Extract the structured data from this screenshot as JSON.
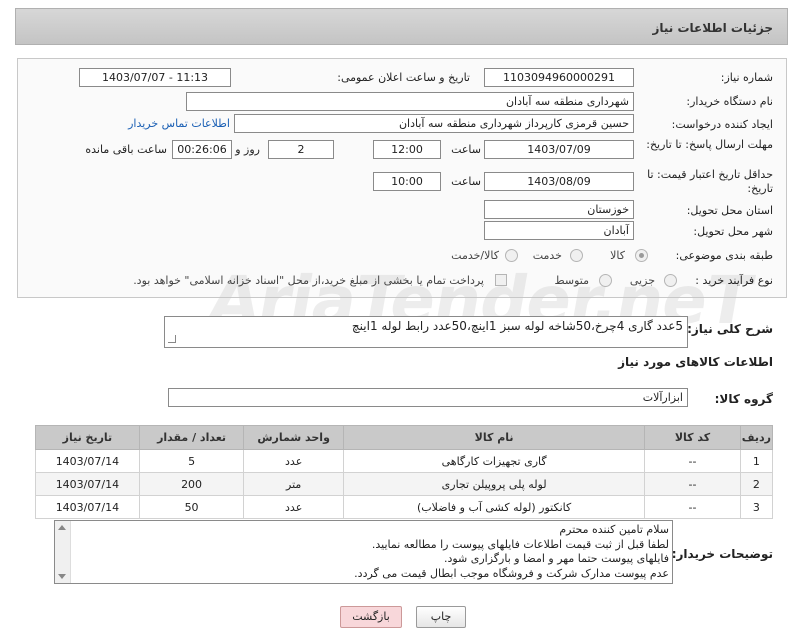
{
  "page": {
    "title": "جزئیات اطلاعات نیاز"
  },
  "labels": {
    "need_number": "شماره نیاز:",
    "announce_datetime": "تاریخ و ساعت اعلان عمومی:",
    "buyer_org": "نام دستگاه خریدار:",
    "requester": "ایجاد کننده درخواست:",
    "contact_link": "اطلاعات تماس خریدار",
    "reply_deadline": "مهلت ارسال پاسخ: تا تاریخ:",
    "hour": "ساعت",
    "day_and": "روز و",
    "remaining": "ساعت باقی مانده",
    "price_validity": "حداقل تاریخ اعتبار قیمت: تا تاریخ:",
    "delivery_province": "استان محل تحویل:",
    "delivery_city": "شهر محل تحویل:",
    "category": "طبقه بندی موضوعی:",
    "process_type": "نوع فرآیند خرید :",
    "general_desc": "شرح کلی نیاز:",
    "goods_info": "اطلاعات کالاهای مورد نیاز",
    "goods_group": "گروه کالا:",
    "buyer_notes": "توضیحات خریدار:"
  },
  "fields": {
    "need_number": "1103094960000291",
    "announce_datetime": "1403/07/07 - 11:13",
    "buyer_org": "شهرداری منطقه سه آبادان",
    "requester": "حسین قرمزی کارپرداز شهرداری منطقه سه آبادان",
    "reply_date": "1403/07/09",
    "reply_time": "12:00",
    "reply_days": "2",
    "reply_remaining": "00:26:06",
    "validity_date": "1403/08/09",
    "validity_time": "10:00",
    "province": "خوزستان",
    "city": "آبادان",
    "general_desc": "5عدد گاری 4چرخ،50شاخه لوله سبز 1اینچ،50عدد رابط لوله 1اینچ",
    "goods_group": "ابزارآلات"
  },
  "category_options": [
    "کالا",
    "خدمت",
    "کالا/خدمت"
  ],
  "category_selected": "کالا",
  "process_options": [
    "جزیی",
    "متوسط"
  ],
  "process_payment_note": "پرداخت تمام یا بخشی از مبلغ خرید،از محل \"اسناد خزانه اسلامی\" خواهد بود.",
  "table": {
    "headers": [
      "ردیف",
      "کد کالا",
      "نام کالا",
      "واحد شمارش",
      "تعداد / مقدار",
      "تاریخ نیاز"
    ],
    "rows": [
      [
        "1",
        "--",
        "گاری تجهیزات کارگاهی",
        "عدد",
        "5",
        "1403/07/14"
      ],
      [
        "2",
        "--",
        "لوله پلی پروپیلن تجاری",
        "متر",
        "200",
        "1403/07/14"
      ],
      [
        "3",
        "--",
        "کانکتور (لوله کشی آب و فاضلاب)",
        "عدد",
        "50",
        "1403/07/14"
      ]
    ]
  },
  "notes_lines": [
    "سلام تامین کننده محترم",
    "لطفا قبل از ثبت قیمت اطلاعات فایلهای پیوست را مطالعه نمایید.",
    "فایلهای پیوست حتما مهر و امضا و بارگزاری شود.",
    "عدم پیوست مدارک شرکت و فروشگاه موجب ابطال قیمت می گردد."
  ],
  "buttons": {
    "print": "چاپ",
    "back": "بازگشت"
  },
  "watermark": "AriaTender.neT",
  "colors": {
    "back_button": "#f8d7da",
    "link": "#1a5fb4"
  }
}
